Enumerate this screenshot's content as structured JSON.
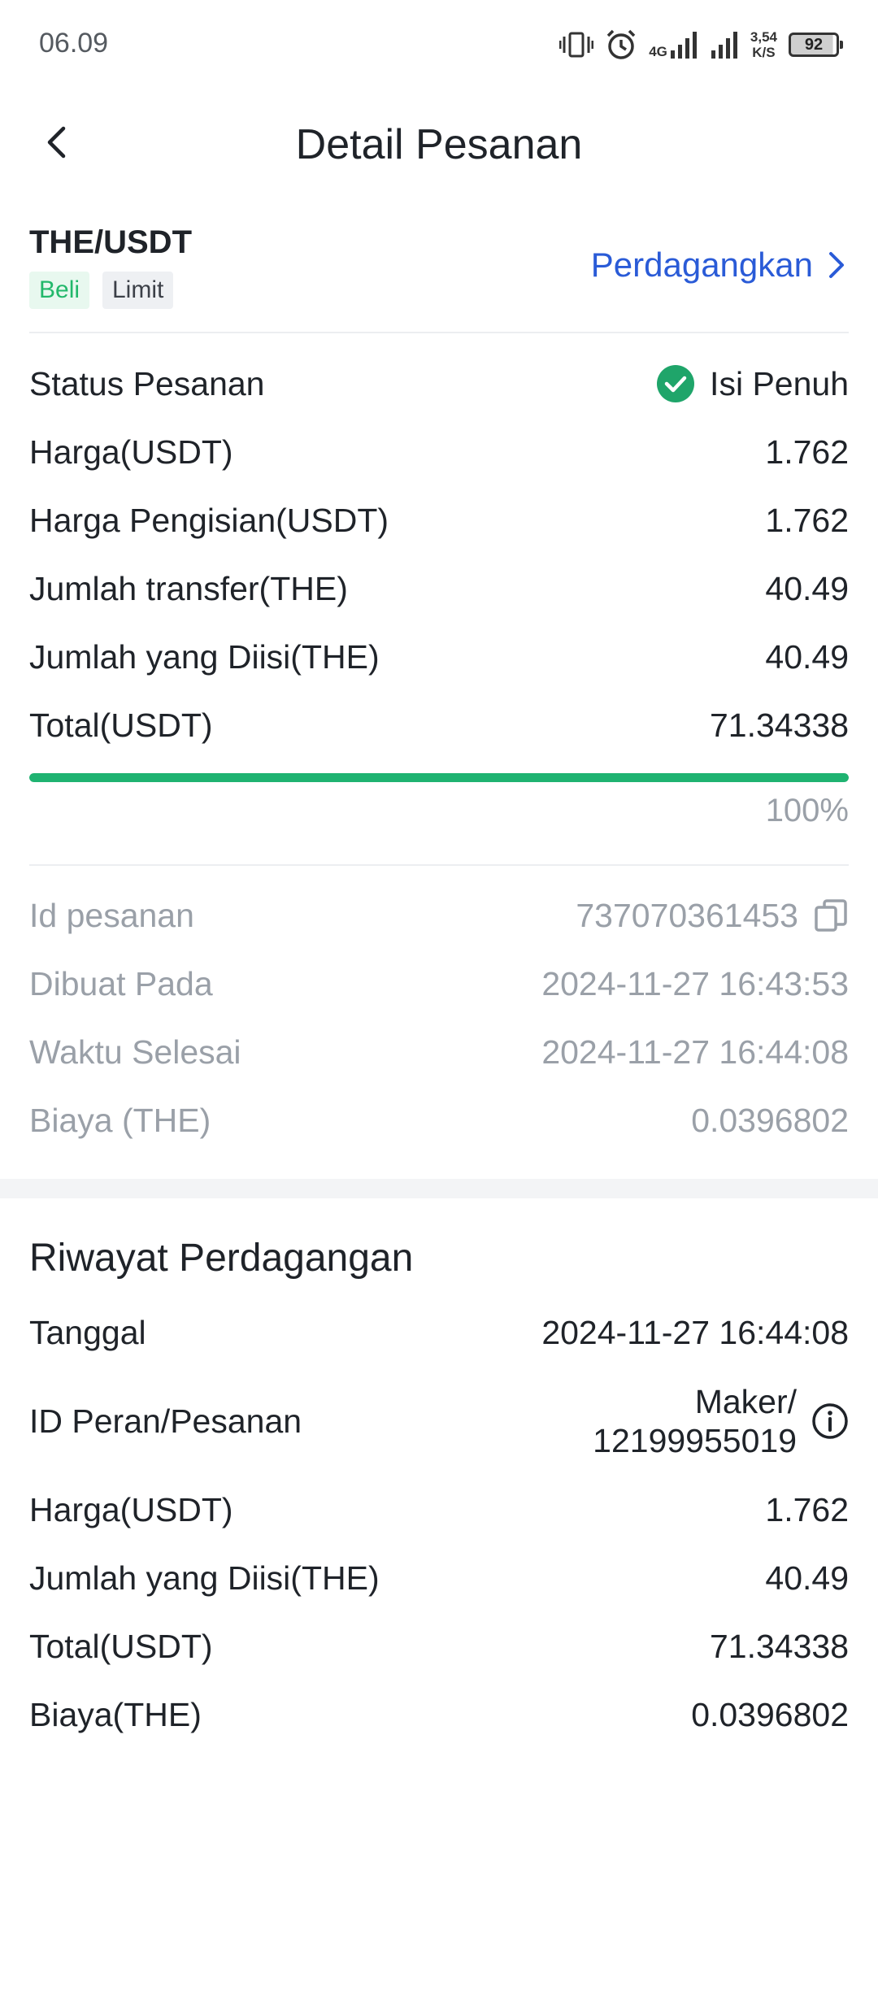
{
  "status_bar": {
    "time": "06.09",
    "net_speed_value": "3,54",
    "net_speed_unit": "K/S",
    "net_type": "4G",
    "battery": "92",
    "icons": [
      "vibrate-icon",
      "alarm-icon",
      "signal-4g-icon",
      "signal-icon",
      "battery-icon"
    ]
  },
  "header": {
    "title": "Detail Pesanan",
    "back_icon": "chevron-left-icon"
  },
  "pair": {
    "name": "THE/USDT",
    "side_tag": "Beli",
    "type_tag": "Limit",
    "trade_link": "Perdagangkan",
    "trade_icon": "chevron-right-icon"
  },
  "order": {
    "status_label": "Status Pesanan",
    "status_value": "Isi Penuh",
    "status_icon": "check-circle-icon",
    "price_label": "Harga(USDT)",
    "price_value": "1.762",
    "fill_price_label": "Harga Pengisian(USDT)",
    "fill_price_value": "1.762",
    "amount_label": "Jumlah transfer(THE)",
    "amount_value": "40.49",
    "filled_label": "Jumlah yang Diisi(THE)",
    "filled_value": "40.49",
    "total_label": "Total(USDT)",
    "total_value": "71.34338",
    "progress_percent": 100,
    "progress_text": "100%"
  },
  "meta": {
    "id_label": "Id pesanan",
    "id_value": "737070361453",
    "copy_icon": "copy-icon",
    "created_label": "Dibuat Pada",
    "created_value": "2024-11-27 16:43:53",
    "finished_label": "Waktu Selesai",
    "finished_value": "2024-11-27 16:44:08",
    "fee_label": "Biaya (THE)",
    "fee_value": "0.0396802"
  },
  "history": {
    "title": "Riwayat Perdagangan",
    "date_label": "Tanggal",
    "date_value": "2024-11-27 16:44:08",
    "role_label": "ID Peran/Pesanan",
    "role_value_line1": "Maker/",
    "role_value_line2": "12199955019",
    "info_icon": "info-icon",
    "price_label": "Harga(USDT)",
    "price_value": "1.762",
    "filled_label": "Jumlah yang Diisi(THE)",
    "filled_value": "40.49",
    "total_label": "Total(USDT)",
    "total_value": "71.34338",
    "fee_label": "Biaya(THE)",
    "fee_value": "0.0396802"
  },
  "colors": {
    "accent_blue": "#2a5bd7",
    "success_green": "#1fb371",
    "muted_text": "#9aa0a8"
  }
}
